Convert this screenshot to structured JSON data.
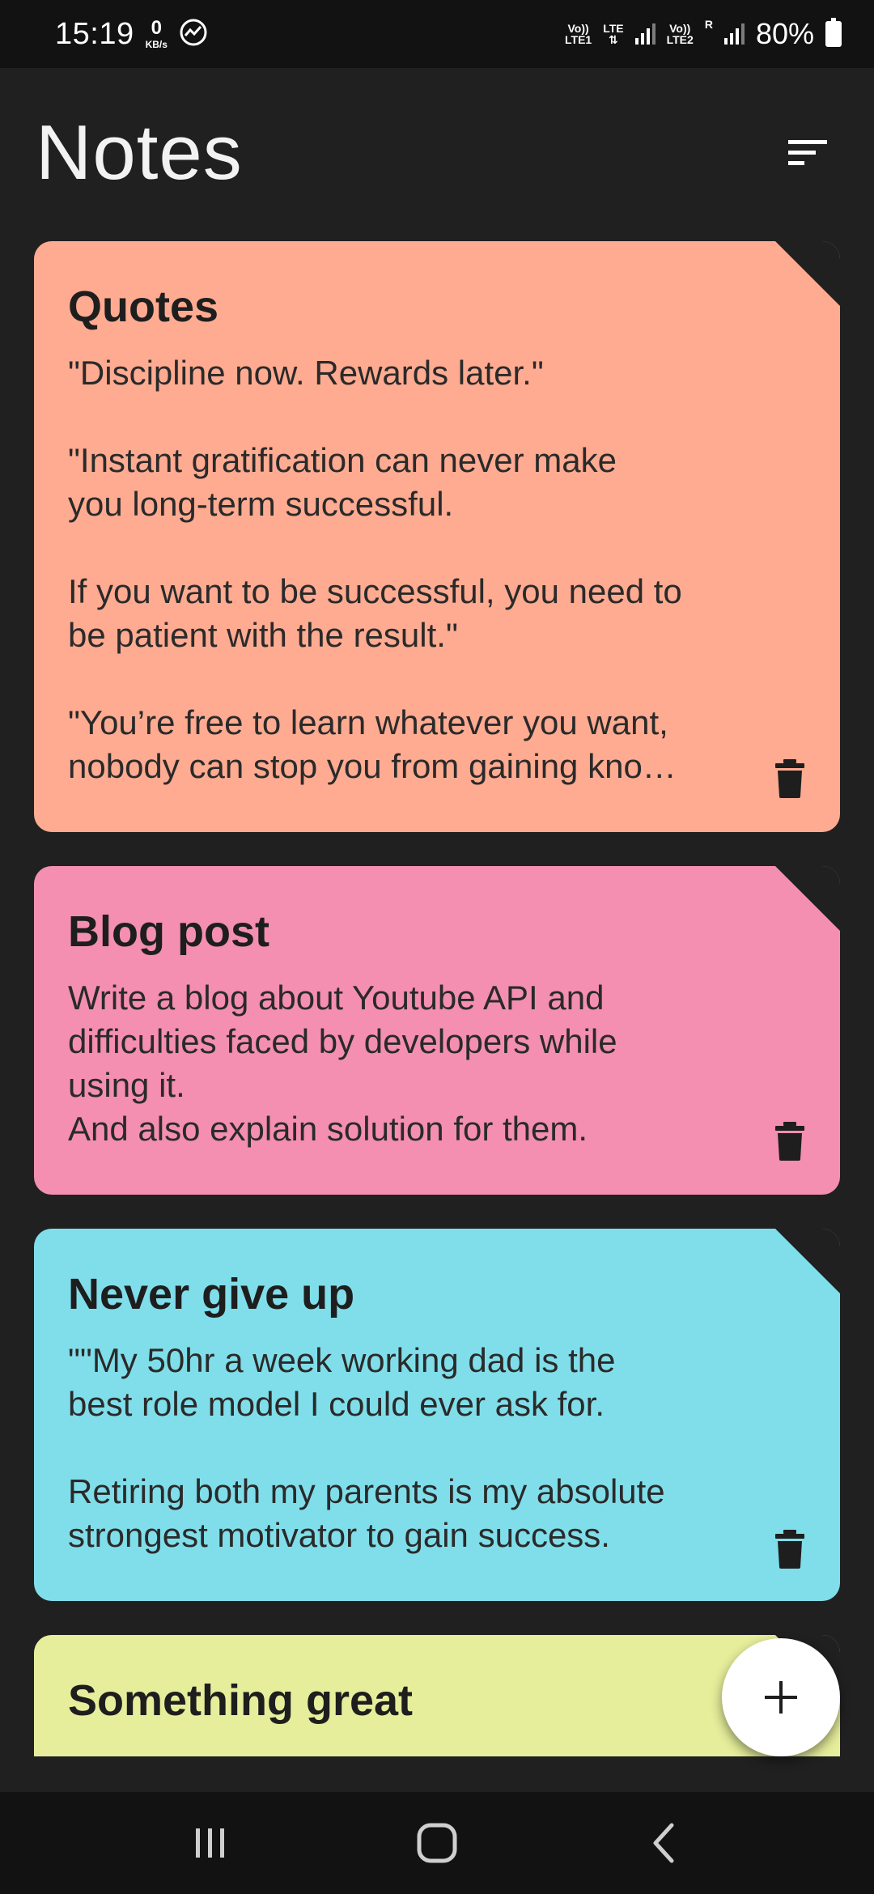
{
  "status_bar": {
    "time": "15:19",
    "speed_value": "0",
    "speed_unit": "KB/s",
    "lte1_top": "Vo))",
    "lte1_bottom": "LTE1",
    "lte_label": "LTE",
    "lte2_top": "Vo))",
    "lte2_bottom": "LTE2",
    "roaming": "R",
    "battery": "80%"
  },
  "header": {
    "title": "Notes",
    "sort_icon": "sort-icon"
  },
  "notes": [
    {
      "title": "Quotes",
      "body": " \"Discipline now. Rewards later.\"\n\n \"Instant gratification can never make\nyou long-term successful.\n\nIf you want to be successful, you need to\nbe patient with the result.\"\n\n\"You’re free to learn whatever you want,\nnobody can stop you from gaining kno…",
      "color": "#FFAB91"
    },
    {
      "title": "Blog post",
      "body": "Write a blog about Youtube API and\ndifficulties faced by developers while\nusing it.\nAnd also explain solution for them.",
      "color": "#F48FB1"
    },
    {
      "title": "Never give up",
      "body": "\"\"My 50hr a week working dad is the\nbest role model I could ever ask for.\n\nRetiring both my parents is my absolute\nstrongest motivator to gain success.",
      "color": "#80DEEA"
    },
    {
      "title": "Something great",
      "body": "",
      "color": "#E6EE9B"
    }
  ],
  "fab": {
    "icon": "plus-icon"
  },
  "nav_bar": {
    "recents_icon": "recents-icon",
    "home_icon": "home-icon",
    "back_icon": "back-icon"
  }
}
